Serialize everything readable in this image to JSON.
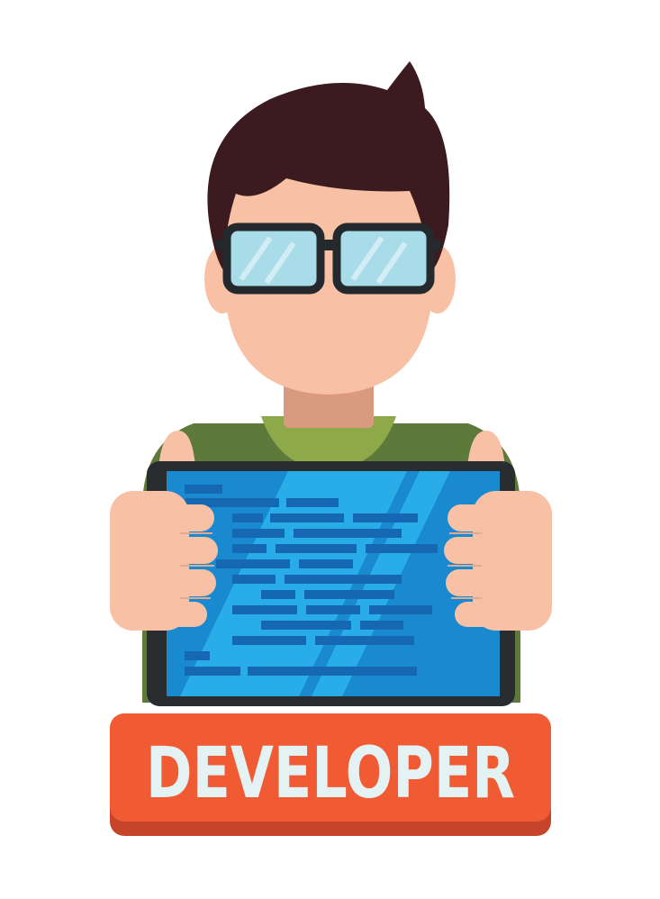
{
  "badge": {
    "label": "DEVELOPER"
  },
  "colors": {
    "hair": "#3b1a20",
    "skin": "#f8c0a4",
    "neck": "#d99a80",
    "shirt_dark": "#5e7a3a",
    "shirt_light": "#8da94a",
    "glasses_frame": "#24292d",
    "glasses_lens": "#a7dce8",
    "tablet_frame": "#2a2d30",
    "screen_bg": "#1a8ad0",
    "screen_light": "#2bb3ec",
    "code_line": "#1668b2",
    "badge_top": "#f05b33",
    "badge_shadow": "#c6442a",
    "badge_text": "#e5f2f3"
  },
  "icons": [
    "developer-avatar",
    "tablet-icon",
    "code-lines-icon",
    "glasses-icon"
  ]
}
